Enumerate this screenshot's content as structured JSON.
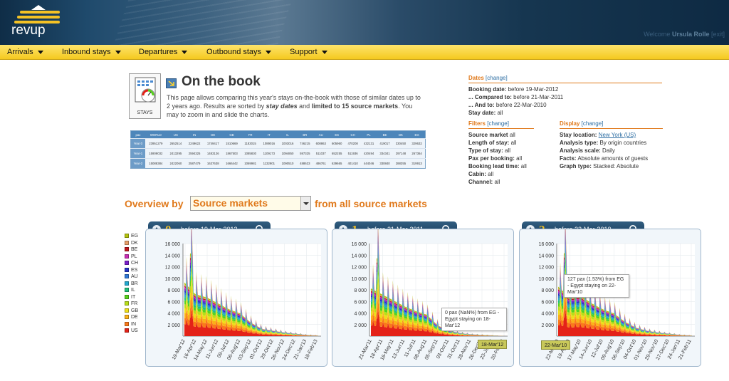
{
  "header": {
    "logo_text": "revup",
    "welcome_label": "Welcome",
    "welcome_user": "Ursula Rolle",
    "welcome_suffix": "[exit]"
  },
  "nav": [
    {
      "label": "Arrivals"
    },
    {
      "label": "Inbound stays"
    },
    {
      "label": "Departures"
    },
    {
      "label": "Outbound stays"
    },
    {
      "label": "Support"
    }
  ],
  "page": {
    "icon_label": "STAYS",
    "title": "On the book",
    "desc_1": "This page allows comparing this year's stays on-the-book with those of similar dates up to 2 years ago. Results are sorted by ",
    "desc_b1": "stay dates",
    "desc_2": " and ",
    "desc_b2": "limited to 15 source markets",
    "desc_3": ". You may to zoom in and slide the charts."
  },
  "table": {
    "headers": [
      "pax",
      "WORLD",
      "US",
      "IN",
      "DE",
      "GB",
      "FR",
      "IT",
      "IL",
      "BR",
      "AU",
      "ES",
      "CH",
      "PL",
      "BE",
      "DK",
      "EG"
    ],
    "rows": [
      [
        "Year 0",
        "23951279",
        "2652514",
        "2249622",
        "1749417",
        "1510669",
        "1183015",
        "1089016",
        "1003016",
        "746215",
        "608863",
        "605960",
        "470208",
        "432131",
        "419017",
        "330450",
        "329632"
      ],
      [
        "Year-1",
        "15909032",
        "2413295",
        "2594325",
        "1483126",
        "1867503",
        "1085830",
        "1109173",
        "1094850",
        "597325",
        "511037",
        "652255",
        "511936",
        "420494",
        "334341",
        "297148",
        "267364"
      ],
      [
        "Year-2",
        "15088384",
        "2422060",
        "2587479",
        "1637638",
        "1666442",
        "1069981",
        "1132901",
        "1090510",
        "488633",
        "486761",
        "639665",
        "401410",
        "444046",
        "330840",
        "288355",
        "319913"
      ]
    ]
  },
  "dates": {
    "title": "Dates",
    "change": "[change]",
    "booking_label": "Booking date:",
    "booking_value": "before 19-Mar-2012",
    "compared_label": "... Compared to:",
    "compared_value": "before 21-Mar-2011",
    "andto_label": "... And to:",
    "andto_value": "before 22-Mar-2010",
    "stay_label": "Stay date:",
    "stay_value": "all"
  },
  "filters": {
    "title": "Filters",
    "change": "[change]",
    "items": [
      {
        "label": "Source market",
        "value": "all"
      },
      {
        "label": "Length of stay:",
        "value": "all"
      },
      {
        "label": "Type of stay:",
        "value": "all"
      },
      {
        "label": "Pax per booking:",
        "value": "all"
      },
      {
        "label": "Booking lead time:",
        "value": "all"
      },
      {
        "label": "Cabin:",
        "value": "all"
      },
      {
        "label": "Channel:",
        "value": "all"
      }
    ]
  },
  "display": {
    "title": "Display",
    "change": "[change]",
    "items": [
      {
        "label": "Stay location:",
        "value": "New York (US)"
      },
      {
        "label": "Analysis type:",
        "value": "By origin countries"
      },
      {
        "label": "Analysis scale:",
        "value": "Daily"
      },
      {
        "label": "Facts:",
        "value": "Absolute amounts of guests"
      },
      {
        "label": "Graph type:",
        "value": "Stacked: Absolute"
      }
    ]
  },
  "overview": {
    "prefix": "Overview by",
    "select_value": "Source markets",
    "suffix": "from all source markets"
  },
  "legend": [
    {
      "label": "EG",
      "color": "#b5c40e"
    },
    {
      "label": "DK",
      "color": "#e8a06a"
    },
    {
      "label": "BE",
      "color": "#c0161d"
    },
    {
      "label": "PL",
      "color": "#ca2cb4"
    },
    {
      "label": "CH",
      "color": "#7a1ecb"
    },
    {
      "label": "ES",
      "color": "#2536c7"
    },
    {
      "label": "AU",
      "color": "#2f78d8"
    },
    {
      "label": "BR",
      "color": "#23a8cf"
    },
    {
      "label": "IL",
      "color": "#22c07a"
    },
    {
      "label": "IT",
      "color": "#57d21b"
    },
    {
      "label": "FR",
      "color": "#b8de18"
    },
    {
      "label": "GB",
      "color": "#eedf18"
    },
    {
      "label": "DE",
      "color": "#fbb117"
    },
    {
      "label": "IN",
      "color": "#fa7a1a"
    },
    {
      "label": "US",
      "color": "#e42218"
    }
  ],
  "panels": [
    {
      "num": "0.",
      "title": "before 19-Mar-2012",
      "yticks": [
        "16 000",
        "14 000",
        "12 000",
        "10 000",
        "8 000",
        "6 000",
        "4 000",
        "2 000"
      ],
      "xticks": [
        "19-Mar'12",
        "16-Apr'12",
        "14-May'12",
        "11-Jun'12",
        "09-Jul'12",
        "06-Aug'12",
        "03-Sep'12",
        "01-Oct'12",
        "29-Oct'12",
        "26-Nov'12",
        "24-Dec'12",
        "21-Jan'13",
        "18-Feb'13"
      ]
    },
    {
      "num": "1.",
      "title": "before 21-Mar-2011",
      "yticks": [
        "16 000",
        "14 000",
        "12 000",
        "10 000",
        "8 000",
        "6 000",
        "4 000",
        "2 000"
      ],
      "xticks": [
        "21-Mar'11",
        "18-Apr'11",
        "16-May'11",
        "13-Jun'11",
        "11-Jul'11",
        "08-Aug'11",
        "05-Sep'11",
        "03-Oct'11",
        "31-Oct'11",
        "28-Nov'11",
        "26-Dec'11",
        "23-Jan'12",
        "20-Feb'12"
      ],
      "tooltip": "0 pax (NaN%) from EG - Egypt staying on 18-Mar'12",
      "flag": "18-Mar'12"
    },
    {
      "num": "2.",
      "title": "before 22-Mar-2010",
      "yticks": [
        "16 000",
        "14 000",
        "12 000",
        "10 000",
        "8 000",
        "6 000",
        "4 000",
        "2 000"
      ],
      "xticks": [
        "22-Mar'10",
        "19-Apr'10",
        "17-May'10",
        "14-Jun'10",
        "12-Jul'10",
        "09-Aug'10",
        "06-Sep'10",
        "04-Oct'10",
        "01-Nov'10",
        "29-Nov'10",
        "27-Dec'10",
        "24-Jan'11",
        "21-Feb'11"
      ],
      "tooltip": "127 pax (1.53%) from EG - Egypt staying on 22-Mar'10",
      "flag": "22-Mar'10"
    }
  ],
  "chart_data": [
    {
      "type": "area",
      "title": "before 19-Mar-2012",
      "ylim": [
        0,
        16000
      ],
      "x": [
        "19-Mar'12",
        "16-Apr'12",
        "14-May'12",
        "11-Jun'12",
        "09-Jul'12",
        "06-Aug'12",
        "03-Sep'12",
        "01-Oct'12",
        "29-Oct'12",
        "26-Nov'12",
        "24-Dec'12",
        "21-Jan'13",
        "18-Feb'13"
      ],
      "series": [
        {
          "name": "total",
          "values": [
            9000,
            7000,
            6500,
            5500,
            4500,
            3800,
            2200,
            1200,
            900,
            600,
            400,
            200,
            100
          ]
        }
      ]
    },
    {
      "type": "area",
      "title": "before 21-Mar-2011",
      "ylim": [
        0,
        16000
      ],
      "x": [
        "21-Mar'11",
        "18-Apr'11",
        "16-May'11",
        "13-Jun'11",
        "11-Jul'11",
        "08-Aug'11",
        "05-Sep'11",
        "03-Oct'11",
        "31-Oct'11",
        "28-Nov'11",
        "26-Dec'11",
        "23-Jan'12",
        "20-Feb'12"
      ],
      "series": [
        {
          "name": "total",
          "values": [
            8000,
            7000,
            6000,
            5000,
            4200,
            3600,
            1800,
            900,
            500,
            300,
            200,
            100,
            0
          ]
        }
      ]
    },
    {
      "type": "area",
      "title": "before 22-Mar-2010",
      "ylim": [
        0,
        16000
      ],
      "x": [
        "22-Mar'10",
        "19-Apr'10",
        "17-May'10",
        "14-Jun'10",
        "12-Jul'10",
        "09-Aug'10",
        "06-Sep'10",
        "04-Oct'10",
        "01-Nov'10",
        "29-Nov'10",
        "27-Dec'10",
        "24-Jan'11",
        "21-Feb'11"
      ],
      "series": [
        {
          "name": "total",
          "values": [
            8300,
            6500,
            6800,
            5500,
            4500,
            3800,
            2400,
            1400,
            900,
            600,
            400,
            200,
            100
          ]
        }
      ]
    }
  ]
}
